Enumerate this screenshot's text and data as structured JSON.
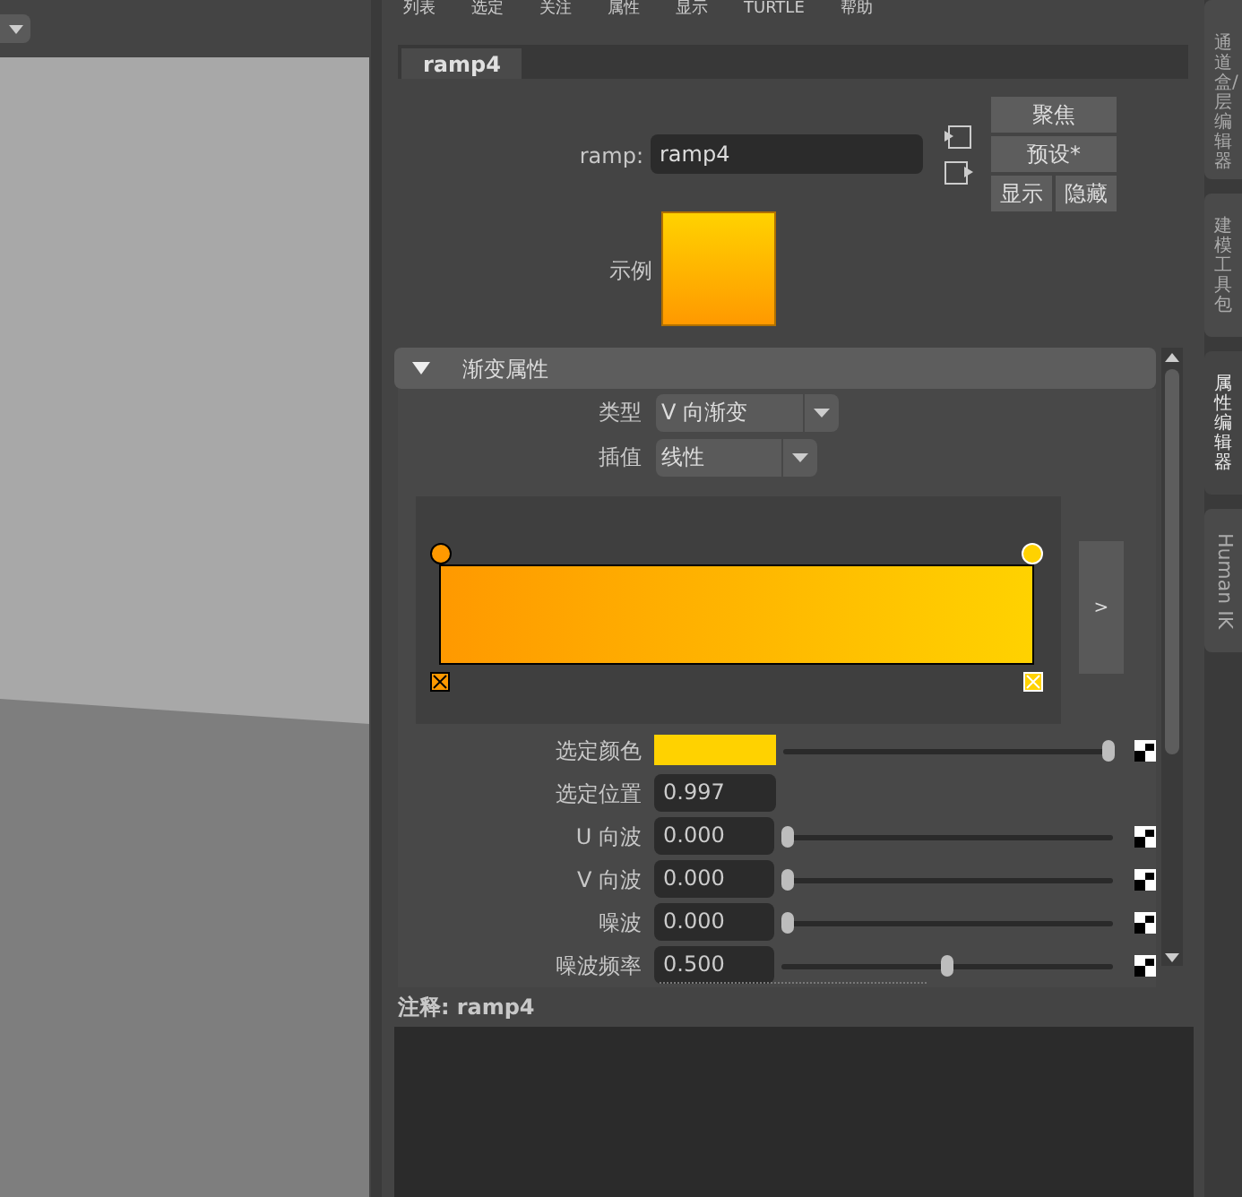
{
  "menu": [
    "列表",
    "选定",
    "关注",
    "属性",
    "显示",
    "TURTLE",
    "帮助"
  ],
  "tabs": [
    {
      "label": "ramp4",
      "selected": true
    }
  ],
  "node": {
    "label": "ramp:",
    "value": "ramp4"
  },
  "buttons": {
    "focus": "聚焦",
    "presets": "预设*",
    "show": "显示",
    "hide": "隐藏"
  },
  "sample": {
    "label": "示例"
  },
  "section": {
    "title": "渐变属性",
    "expanded": true
  },
  "dropdowns": [
    {
      "label": "类型",
      "value": "V 向渐变"
    },
    {
      "label": "插值",
      "value": "线性"
    }
  ],
  "ramp": {
    "stops": [
      {
        "color": "#ff9900",
        "selected": false
      },
      {
        "color": "#ffd200",
        "selected": true
      }
    ],
    "expand_button": ">"
  },
  "attributes": [
    {
      "kind": "color",
      "label": "选定颜色",
      "color": "#ffd200",
      "level": 1
    },
    {
      "kind": "field",
      "label": "选定位置",
      "value": "0.997"
    },
    {
      "kind": "slider",
      "label": "U 向波",
      "value": "0.000",
      "level": 0
    },
    {
      "kind": "slider",
      "label": "V 向波",
      "value": "0.000",
      "level": 0
    },
    {
      "kind": "slider",
      "label": "噪波",
      "value": "0.000",
      "level": 0
    },
    {
      "kind": "slider",
      "label": "噪波频率",
      "value": "0.500",
      "level": 0.5
    }
  ],
  "notes": {
    "label": "注释:",
    "value": "ramp4"
  },
  "side_tabs": [
    {
      "label": "通道盒/层编辑器",
      "kind": "cjk",
      "selected": false
    },
    {
      "label": "建模工具包",
      "kind": "cjk",
      "selected": false
    },
    {
      "label": "属性编辑器",
      "kind": "cjk",
      "selected": true
    },
    {
      "label": "Human IK",
      "kind": "latin",
      "selected": false
    }
  ]
}
